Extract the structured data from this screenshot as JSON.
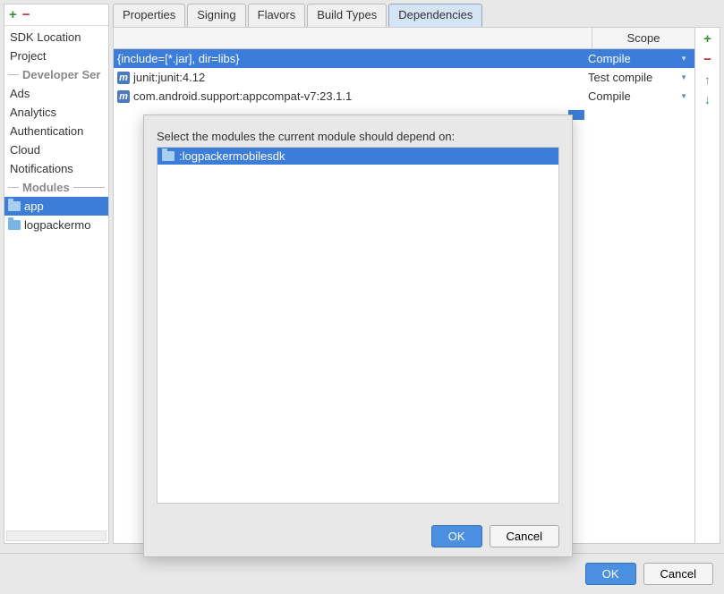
{
  "sidebar": {
    "items": [
      {
        "label": "SDK Location"
      },
      {
        "label": "Project"
      }
    ],
    "devServicesHeader": "Developer Ser",
    "devServices": [
      {
        "label": "Ads"
      },
      {
        "label": "Analytics"
      },
      {
        "label": "Authentication"
      },
      {
        "label": "Cloud"
      },
      {
        "label": "Notifications"
      }
    ],
    "modulesHeader": "Modules",
    "modules": [
      {
        "label": "app",
        "selected": true
      },
      {
        "label": "logpackermo",
        "selected": false
      }
    ]
  },
  "tabs": [
    {
      "label": "Properties",
      "active": false
    },
    {
      "label": "Signing",
      "active": false
    },
    {
      "label": "Flavors",
      "active": false
    },
    {
      "label": "Build Types",
      "active": false
    },
    {
      "label": "Dependencies",
      "active": true
    }
  ],
  "dependencies": {
    "scopeHeader": "Scope",
    "rows": [
      {
        "name": "{include=[*.jar], dir=libs}",
        "scope": "Compile",
        "icon": "none",
        "selected": true
      },
      {
        "name": "junit:junit:4.12",
        "scope": "Test compile",
        "icon": "m",
        "selected": false
      },
      {
        "name": "com.android.support:appcompat-v7:23.1.1",
        "scope": "Compile",
        "icon": "m",
        "selected": false
      }
    ]
  },
  "dialog": {
    "label": "Select the modules the current module should depend on:",
    "items": [
      {
        "label": ":logpackermobilesdk",
        "selected": true
      }
    ],
    "okLabel": "OK",
    "cancelLabel": "Cancel"
  },
  "footer": {
    "okLabel": "OK",
    "cancelLabel": "Cancel"
  }
}
